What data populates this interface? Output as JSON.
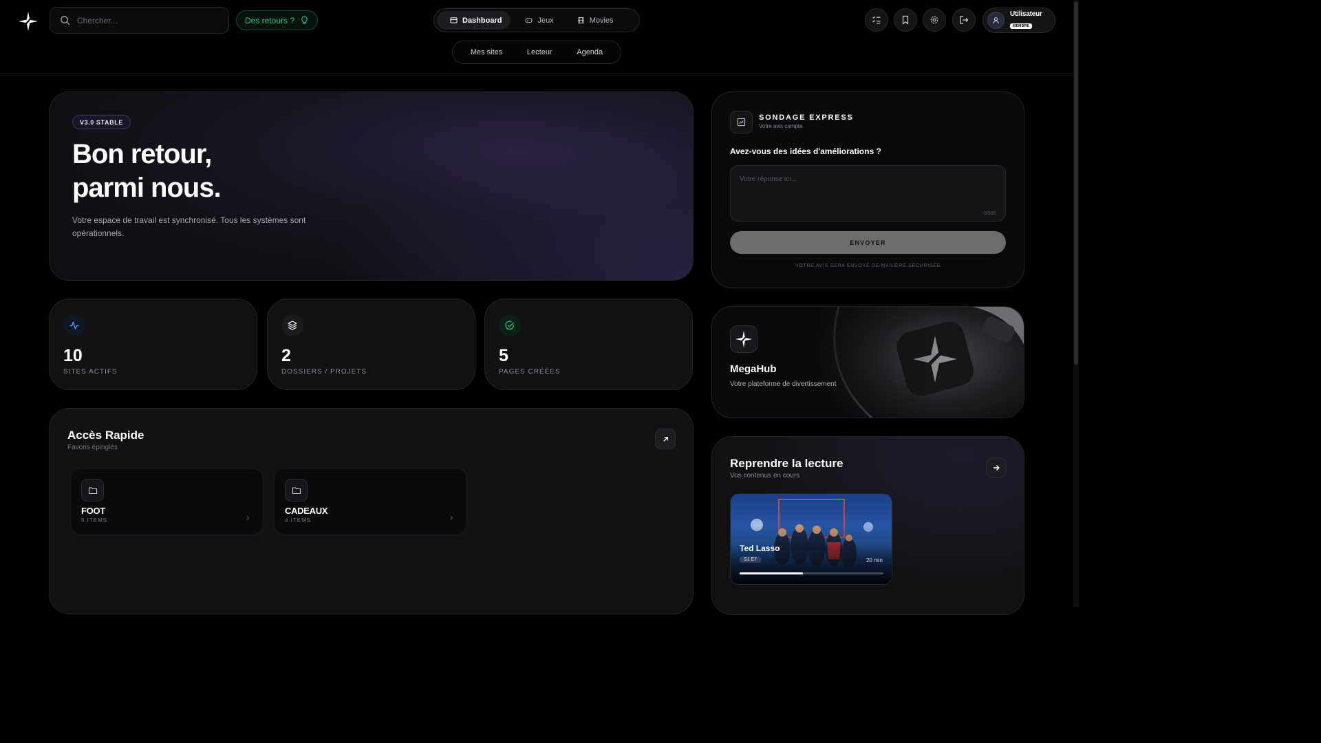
{
  "header": {
    "search_placeholder": "Chercher...",
    "feedback_label": "Des retours ?",
    "nav_tabs": [
      {
        "label": "Dashboard",
        "icon": "dashboard-icon",
        "active": true
      },
      {
        "label": "Jeux",
        "icon": "gamepad-icon",
        "active": false
      },
      {
        "label": "Movies",
        "icon": "film-icon",
        "active": false
      }
    ],
    "sub_nav": [
      "Mes sites",
      "Lecteur",
      "Agenda"
    ],
    "actions": [
      "checklist-icon",
      "bookmark-icon",
      "gear-icon",
      "logout-icon"
    ],
    "user": {
      "name": "Utilisateur",
      "badge": "MEMBRE"
    }
  },
  "hero": {
    "badge": "V3.0 STABLE",
    "title_line1": "Bon retour,",
    "title_line2": "parmi nous.",
    "description": "Votre espace de travail est synchronisé. Tous les systèmes sont opérationnels."
  },
  "stats": [
    {
      "value": "10",
      "label": "SITES ACTIFS",
      "icon": "activity-icon",
      "color": "#4fa3ff"
    },
    {
      "value": "2",
      "label": "DOSSIERS / PROJETS",
      "icon": "layers-icon",
      "color": "#ffffff"
    },
    {
      "value": "5",
      "label": "PAGES CRÉÉES",
      "icon": "check-circle-icon",
      "color": "#22c77e"
    }
  ],
  "quick_access": {
    "title": "Accès Rapide",
    "subtitle": "Favoris épinglés",
    "folders": [
      {
        "name": "FOOT",
        "count": "5 ITEMS"
      },
      {
        "name": "CADEAUX",
        "count": "4 ITEMS"
      }
    ]
  },
  "survey": {
    "title": "SONDAGE EXPRESS",
    "subtitle": "Votre avis compte",
    "question": "Avez-vous des idées d'améliorations ?",
    "placeholder": "Votre réponse ici...",
    "counter": "0/500",
    "submit_label": "ENVOYER",
    "note": "VOTRE AVIS SERA ENVOYÉ DE MANIÈRE SÉCURISÉE"
  },
  "brand": {
    "name": "MegaHub",
    "tagline": "Votre plateforme de divertissement"
  },
  "resume": {
    "title": "Reprendre la lecture",
    "subtitle": "Vos contenus en cours",
    "item": {
      "title": "Ted Lasso",
      "episode": "S1 E7",
      "duration": "20 min",
      "progress": 0.44
    }
  },
  "colors": {
    "accent_green": "#22c77e",
    "accent_blue": "#4fa3ff",
    "background": "#000000",
    "card": "#111113"
  }
}
